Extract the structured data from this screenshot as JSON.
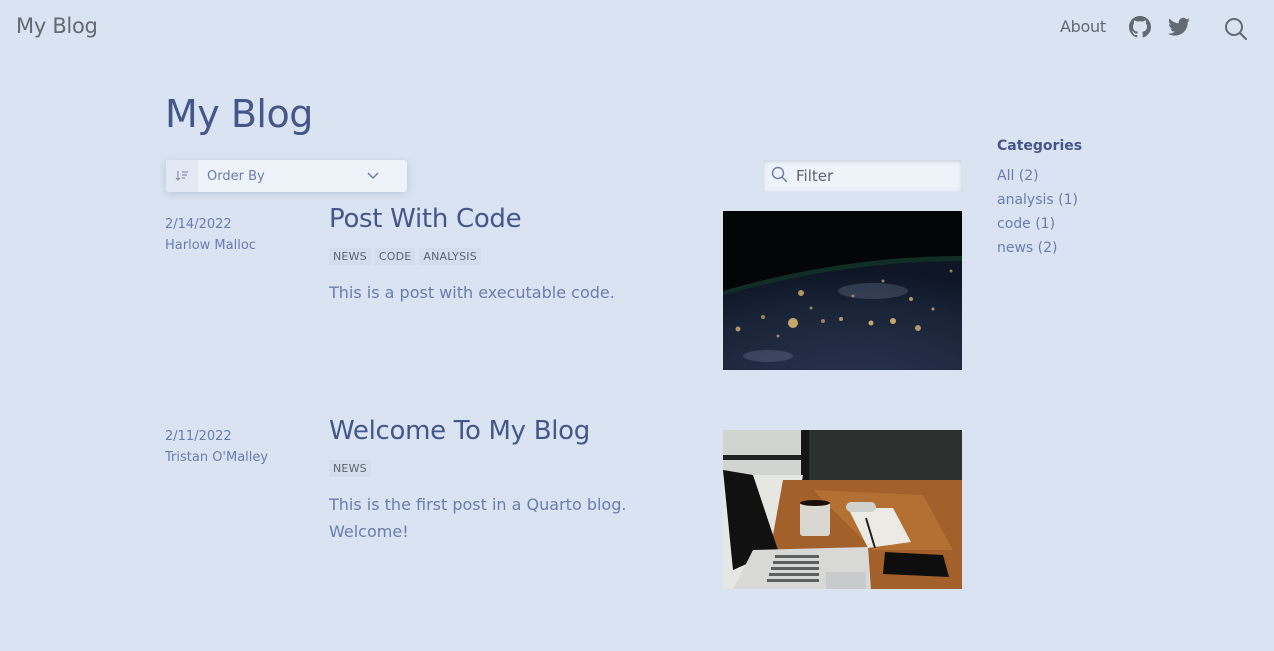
{
  "navbar": {
    "brand": "My Blog",
    "about": "About",
    "icons": [
      "github-icon",
      "twitter-icon",
      "search-icon"
    ]
  },
  "listing": {
    "title": "My Blog",
    "order_by_label": "Order By",
    "filter_placeholder": "Filter"
  },
  "posts": [
    {
      "date": "2/14/2022",
      "author": "Harlow Malloc",
      "title": "Post With Code",
      "tags": [
        "NEWS",
        "CODE",
        "ANALYSIS"
      ],
      "description": "This is a post with executable code.",
      "image": "earth-at-night"
    },
    {
      "date": "2/11/2022",
      "author": "Tristan O'Malley",
      "title": "Welcome To My Blog",
      "tags": [
        "NEWS"
      ],
      "description": "This is the first post in a Quarto blog. Welcome!",
      "image": "laptop-on-desk"
    }
  ],
  "categories": {
    "heading": "Categories",
    "items": [
      {
        "label": "All (2)"
      },
      {
        "label": "analysis (1)"
      },
      {
        "label": "code (1)"
      },
      {
        "label": "news (2)"
      }
    ]
  },
  "colors": {
    "background": "#dae3f2",
    "primary": "#45578a",
    "link": "#6a7cb0",
    "nav_text": "#636a72"
  }
}
